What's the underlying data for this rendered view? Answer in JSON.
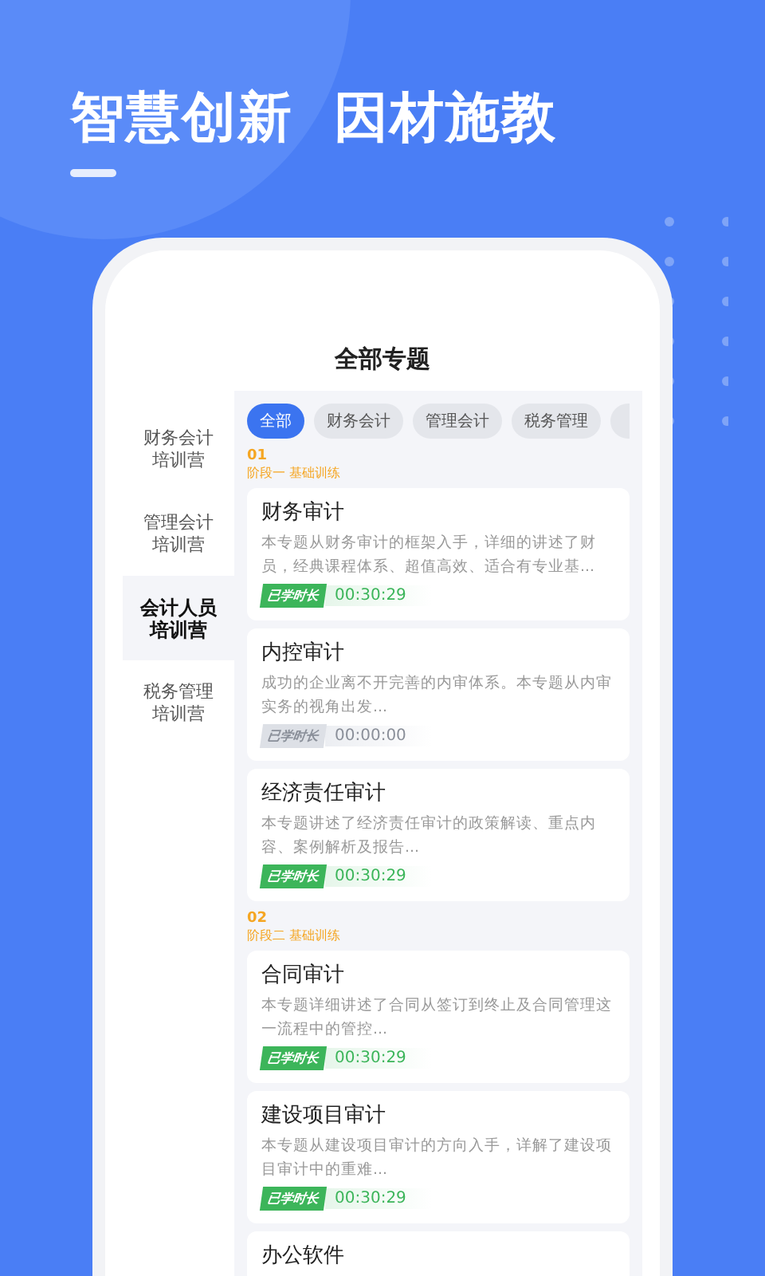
{
  "headline": "智慧创新  因材施教",
  "screen_title": "全部专题",
  "sidebar": [
    {
      "label": "财务会计培训营",
      "selected": false
    },
    {
      "label": "管理会计培训营",
      "selected": false
    },
    {
      "label": "会计人员培训营",
      "selected": true
    },
    {
      "label": "税务管理培训营",
      "selected": false
    }
  ],
  "filters": [
    {
      "label": "全部",
      "selected": true
    },
    {
      "label": "财务会计",
      "selected": false
    },
    {
      "label": "管理会计",
      "selected": false
    },
    {
      "label": "税务管理",
      "selected": false
    }
  ],
  "sections": [
    {
      "number": "01",
      "stage": "阶段一 基础训练",
      "courses": [
        {
          "title": "财务审计",
          "description": "本专题从财务审计的框架入手，详细的讲述了财员，经典课程体系、超值高效、适合有专业基...",
          "progress_label": "已学时长",
          "time": "00:30:29",
          "started": true
        },
        {
          "title": "内控审计",
          "description": "成功的企业离不开完善的内审体系。本专题从内审实务的视角出发...",
          "progress_label": "已学时长",
          "time": "00:00:00",
          "started": false
        },
        {
          "title": "经济责任审计",
          "description": "本专题讲述了经济责任审计的政策解读、重点内容、案例解析及报告...",
          "progress_label": "已学时长",
          "time": "00:30:29",
          "started": true
        }
      ]
    },
    {
      "number": "02",
      "stage": "阶段二 基础训练",
      "courses": [
        {
          "title": "合同审计",
          "description": "本专题详细讲述了合同从签订到终止及合同管理这一流程中的管控...",
          "progress_label": "已学时长",
          "time": "00:30:29",
          "started": true
        },
        {
          "title": "建设项目审计",
          "description": "本专题从建设项目审计的方向入手，详解了建设项目审计中的重难...",
          "progress_label": "已学时长",
          "time": "00:30:29",
          "started": true
        },
        {
          "title": "办公软件"
        }
      ]
    }
  ]
}
